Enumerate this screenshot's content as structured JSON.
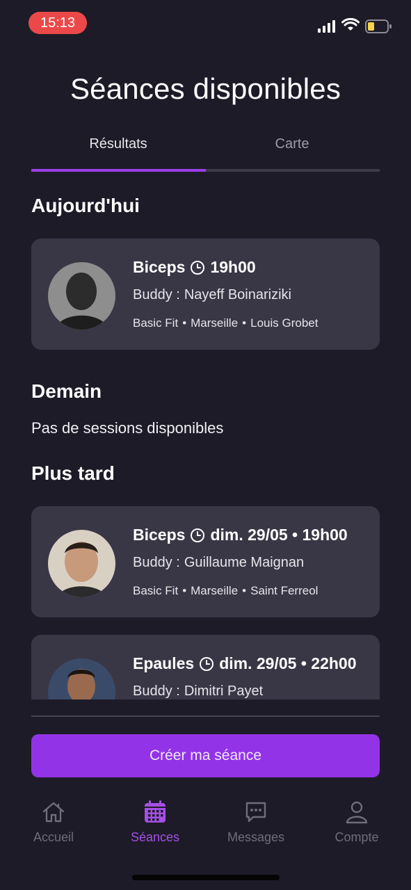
{
  "status_bar": {
    "time": "15:13"
  },
  "header": {
    "title": "Séances disponibles"
  },
  "tabs": [
    {
      "label": "Résultats",
      "active": true
    },
    {
      "label": "Carte",
      "active": false
    }
  ],
  "sections": {
    "today": {
      "heading": "Aujourd'hui"
    },
    "tomorrow": {
      "heading": "Demain",
      "empty_text": "Pas de sessions disponibles"
    },
    "later": {
      "heading": "Plus tard"
    }
  },
  "sessions": [
    {
      "exercise": "Biceps",
      "when": "19h00",
      "buddy_prefix": "Buddy :",
      "buddy": "Nayeff Boinariziki",
      "gym": "Basic Fit",
      "city": "Marseille",
      "location": "Louis Grobet",
      "avatar_icon": "person-photo"
    },
    {
      "exercise": "Biceps",
      "when": "dim. 29/05 • 19h00",
      "buddy_prefix": "Buddy :",
      "buddy": "Guillaume Maignan",
      "gym": "Basic Fit",
      "city": "Marseille",
      "location": "Saint Ferreol",
      "avatar_icon": "person-photo"
    },
    {
      "exercise": "Epaules",
      "when": "dim. 29/05 • 22h00",
      "buddy_prefix": "Buddy :",
      "buddy": "Dimitri Payet",
      "avatar_icon": "person-photo"
    }
  ],
  "meta_separator": "•",
  "create_button": {
    "label": "Créer ma séance"
  },
  "tab_bar": [
    {
      "label": "Accueil",
      "icon": "home-icon",
      "active": false
    },
    {
      "label": "Séances",
      "icon": "calendar-icon",
      "active": true
    },
    {
      "label": "Messages",
      "icon": "message-icon",
      "active": false
    },
    {
      "label": "Compte",
      "icon": "user-icon",
      "active": false
    }
  ],
  "colors": {
    "background": "#1d1b28",
    "card": "#393746",
    "accent": "#9333e8",
    "time_pill": "#eb4949"
  }
}
